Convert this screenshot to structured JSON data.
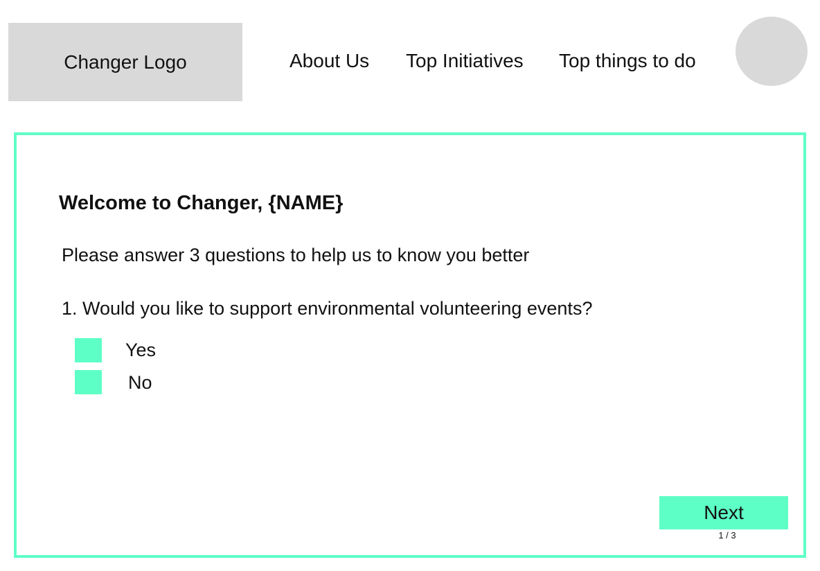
{
  "header": {
    "logo_text": "Changer Logo",
    "nav": {
      "about": "About Us",
      "initiatives": "Top Initiatives",
      "todo": "Top things to do"
    }
  },
  "survey": {
    "title": "Welcome to Changer, {NAME}",
    "subtitle": "Please answer 3 questions to help us to know you better",
    "question": "1. Would you like to support environmental volunteering events?",
    "options": [
      {
        "label": "Yes",
        "checked": false
      },
      {
        "label": "No",
        "checked": false
      }
    ],
    "next_label": "Next",
    "progress_text": "1 / 3"
  },
  "colors": {
    "accent": "#5effc6",
    "placeholder_gray": "#d9d9d9"
  }
}
